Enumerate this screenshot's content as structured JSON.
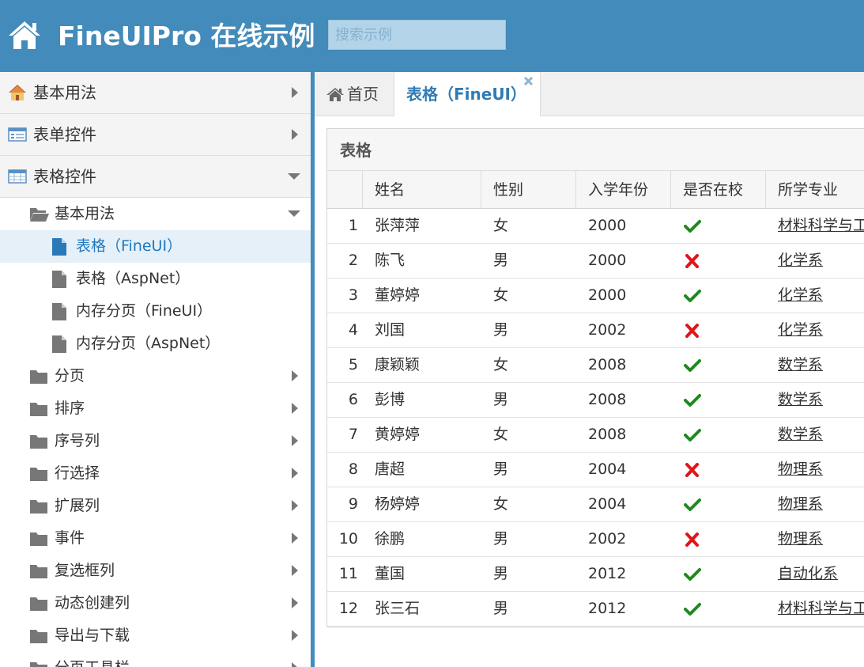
{
  "header": {
    "title": "FineUIPro 在线示例",
    "search_placeholder": "搜索示例",
    "colors": {
      "brand": "#428bba"
    }
  },
  "sidebar": {
    "accordion": [
      {
        "label": "基本用法",
        "icon": "house-icon",
        "expanded": false
      },
      {
        "label": "表单控件",
        "icon": "form-icon",
        "expanded": false
      },
      {
        "label": "表格控件",
        "icon": "table-icon",
        "expanded": true
      }
    ],
    "tree": [
      {
        "label": "基本用法",
        "icon": "folder-open-icon",
        "level": 1,
        "expanded": true
      },
      {
        "label": "表格（FineUI）",
        "icon": "file-icon",
        "level": 2,
        "selected": true
      },
      {
        "label": "表格（AspNet）",
        "icon": "file-icon",
        "level": 2
      },
      {
        "label": "内存分页（FineUI）",
        "icon": "file-icon",
        "level": 2
      },
      {
        "label": "内存分页（AspNet）",
        "icon": "file-icon",
        "level": 2
      },
      {
        "label": "分页",
        "icon": "folder-icon",
        "level": 1
      },
      {
        "label": "排序",
        "icon": "folder-icon",
        "level": 1
      },
      {
        "label": "序号列",
        "icon": "folder-icon",
        "level": 1
      },
      {
        "label": "行选择",
        "icon": "folder-icon",
        "level": 1
      },
      {
        "label": "扩展列",
        "icon": "folder-icon",
        "level": 1
      },
      {
        "label": "事件",
        "icon": "folder-icon",
        "level": 1
      },
      {
        "label": "复选框列",
        "icon": "folder-icon",
        "level": 1
      },
      {
        "label": "动态创建列",
        "icon": "folder-icon",
        "level": 1
      },
      {
        "label": "导出与下载",
        "icon": "folder-icon",
        "level": 1
      },
      {
        "label": "分页工具栏",
        "icon": "folder-icon",
        "level": 1
      }
    ]
  },
  "tabs": [
    {
      "label": "首页",
      "icon": "home-icon"
    },
    {
      "label": "表格（FineUI）",
      "active": true,
      "closable": true
    }
  ],
  "grid": {
    "title": "表格",
    "columns": [
      "姓名",
      "性别",
      "入学年份",
      "是否在校",
      "所学专业"
    ],
    "rows": [
      {
        "no": "1",
        "name": "张萍萍",
        "gender": "女",
        "year": "2000",
        "at_school": true,
        "major": "材料科学与工程系"
      },
      {
        "no": "2",
        "name": "陈飞",
        "gender": "男",
        "year": "2000",
        "at_school": false,
        "major": "化学系"
      },
      {
        "no": "3",
        "name": "董婷婷",
        "gender": "女",
        "year": "2000",
        "at_school": true,
        "major": "化学系"
      },
      {
        "no": "4",
        "name": "刘国",
        "gender": "男",
        "year": "2002",
        "at_school": false,
        "major": "化学系"
      },
      {
        "no": "5",
        "name": "康颖颖",
        "gender": "女",
        "year": "2008",
        "at_school": true,
        "major": "数学系"
      },
      {
        "no": "6",
        "name": "彭博",
        "gender": "男",
        "year": "2008",
        "at_school": true,
        "major": "数学系"
      },
      {
        "no": "7",
        "name": "黄婷婷",
        "gender": "女",
        "year": "2008",
        "at_school": true,
        "major": "数学系"
      },
      {
        "no": "8",
        "name": "唐超",
        "gender": "男",
        "year": "2004",
        "at_school": false,
        "major": "物理系"
      },
      {
        "no": "9",
        "name": "杨婷婷",
        "gender": "女",
        "year": "2004",
        "at_school": true,
        "major": "物理系"
      },
      {
        "no": "10",
        "name": "徐鹏",
        "gender": "男",
        "year": "2002",
        "at_school": false,
        "major": "物理系"
      },
      {
        "no": "11",
        "name": "董国",
        "gender": "男",
        "year": "2012",
        "at_school": true,
        "major": "自动化系"
      },
      {
        "no": "12",
        "name": "张三石",
        "gender": "男",
        "year": "2012",
        "at_school": true,
        "major": "材料科学与工程系"
      }
    ],
    "colors": {
      "check": "#1e8a1e",
      "cross": "#e0161b",
      "link": "#333333"
    }
  }
}
